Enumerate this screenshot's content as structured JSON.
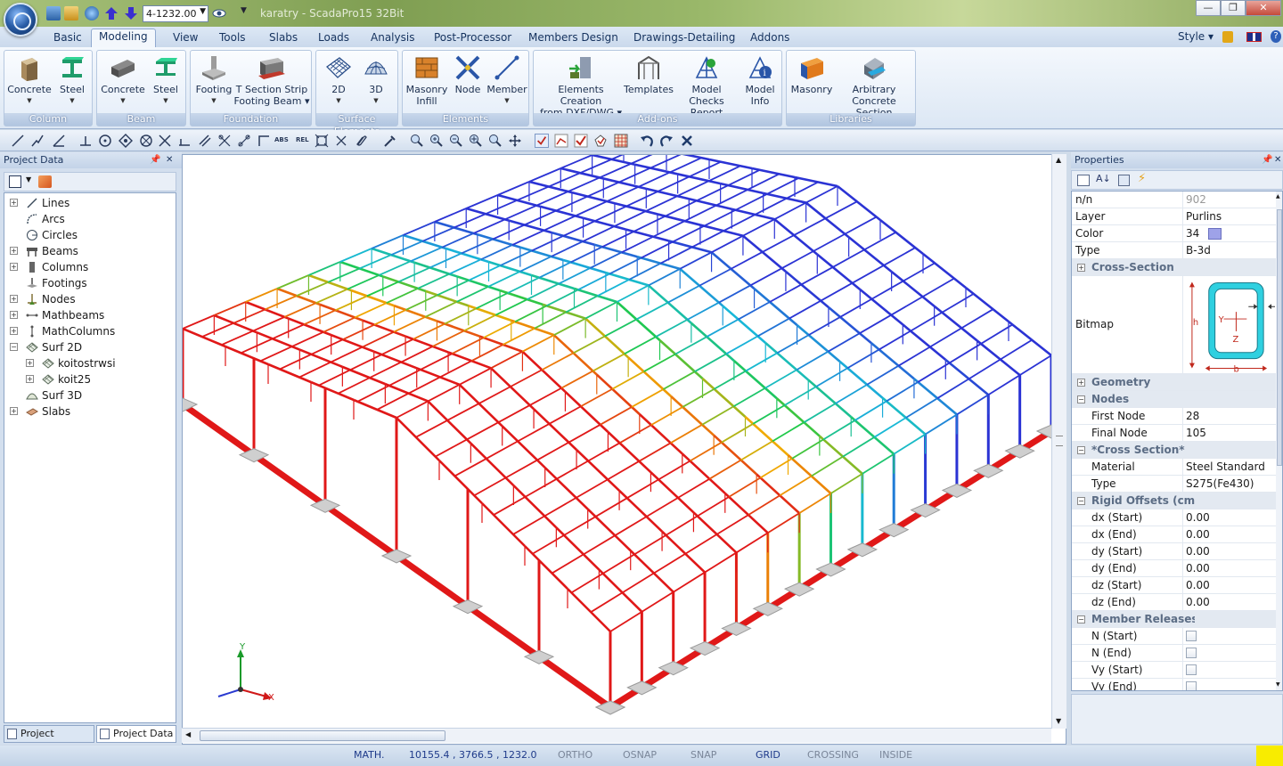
{
  "window": {
    "title": "karatry - ScadaPro15 32Bit",
    "quick_access_value": "4-1232.00"
  },
  "ribbon_tabs": [
    "Basic",
    "Modeling",
    "View",
    "Tools",
    "Slabs",
    "Loads",
    "Analysis",
    "Post-Processor",
    "Members Design",
    "Drawings-Detailing",
    "Addons"
  ],
  "active_tab": "Modeling",
  "style_label": "Style",
  "ribbon": {
    "groups": [
      {
        "label": "Column",
        "buttons": [
          "Concrete",
          "Steel"
        ]
      },
      {
        "label": "Beam",
        "buttons": [
          "Concrete",
          "Steel"
        ]
      },
      {
        "label": "Foundation",
        "buttons": [
          "Footing",
          "T Section Strip Footing Beam"
        ]
      },
      {
        "label": "Surface Elements",
        "buttons": [
          "2D",
          "3D"
        ]
      },
      {
        "label": "Elements",
        "buttons": [
          "Masonry Infill",
          "Node",
          "Member"
        ]
      },
      {
        "label": "Add-ons",
        "buttons": [
          "Elements Creation from DXF/DWG",
          "Templates",
          "Model Checks Report",
          "Model Info"
        ]
      },
      {
        "label": "Libraries",
        "buttons": [
          "Masonry",
          "Arbitrary Concrete Section"
        ]
      }
    ],
    "btn": {
      "col_concrete": "Concrete",
      "col_steel": "Steel",
      "beam_concrete": "Concrete",
      "beam_steel": "Steel",
      "footing": "Footing",
      "tsection_l1": "T Section Strip",
      "tsection_l2": "Footing Beam",
      "s2d": "2D",
      "s3d": "3D",
      "masonry_l1": "Masonry",
      "masonry_l2": "Infill",
      "node": "Node",
      "member": "Member",
      "elc_l1": "Elements Creation",
      "elc_l2": "from DXF/DWG",
      "templates": "Templates",
      "checks_l1": "Model Checks",
      "checks_l2": "Report",
      "info_l1": "Model",
      "info_l2": "Info",
      "lib_masonry": "Masonry",
      "arb_l1": "Arbitrary",
      "arb_l2": "Concrete Section"
    },
    "group_labels": {
      "column": "Column",
      "beam": "Beam",
      "foundation": "Foundation",
      "surface": "Surface Elements",
      "elements": "Elements",
      "addons": "Add-ons",
      "libraries": "Libraries"
    }
  },
  "toolbar": {
    "abs_label": "ABS",
    "rel_label": "REL"
  },
  "project_panel": {
    "title": "Project Data",
    "tree": [
      {
        "label": "Lines",
        "icon": "line-icon"
      },
      {
        "label": "Arcs",
        "icon": "arc-icon"
      },
      {
        "label": "Circles",
        "icon": "circle-icon"
      },
      {
        "label": "Beams",
        "icon": "beam-icon"
      },
      {
        "label": "Columns",
        "icon": "column-icon"
      },
      {
        "label": "Footings",
        "icon": "footing-icon"
      },
      {
        "label": "Nodes",
        "icon": "node-icon"
      },
      {
        "label": "Mathbeams",
        "icon": "mathbeam-icon"
      },
      {
        "label": "MathColumns",
        "icon": "mathcolumn-icon"
      },
      {
        "label": "Surf 2D",
        "icon": "surf2d-icon"
      },
      {
        "label": "koitostrwsi",
        "icon": "mesh-icon"
      },
      {
        "label": "koit25",
        "icon": "mesh-icon"
      },
      {
        "label": "Surf 3D",
        "icon": "surf3d-icon"
      },
      {
        "label": "Slabs",
        "icon": "slab-icon"
      }
    ],
    "bottom_tabs": [
      "Project Param...",
      "Project Data"
    ]
  },
  "viewport": {
    "axis_x": "X",
    "axis_y": "Y",
    "colors": {
      "high": "#e01818",
      "mid": "#1fc94a",
      "low": "#2b33d4",
      "footing": "#cfcfcf"
    }
  },
  "properties": {
    "title": "Properties",
    "rows": {
      "nn": {
        "k": "n/n",
        "v": "902"
      },
      "layer": {
        "k": "Layer",
        "v": "Purlins"
      },
      "color": {
        "k": "Color",
        "v": "34",
        "swatch": "#9ea2e8"
      },
      "type": {
        "k": "Type",
        "v": "B-3d"
      },
      "cross_section_cat": "Cross-Section",
      "bitmap": {
        "k": "Bitmap",
        "h": "h",
        "b": "b",
        "y": "Y",
        "z": "Z"
      },
      "geometry_cat": "Geometry",
      "nodes_cat": "Nodes",
      "first_node": {
        "k": "First Node",
        "v": "28"
      },
      "final_node": {
        "k": "Final Node",
        "v": "105"
      },
      "cross_section2_cat": "*Cross Section*",
      "material": {
        "k": "Material",
        "v": "Steel Standard"
      },
      "type2": {
        "k": "Type",
        "v": "S275(Fe430)"
      },
      "rigid_cat": "Rigid Offsets (cm)",
      "dx_start": {
        "k": "dx (Start)",
        "v": "0.00"
      },
      "dx_end": {
        "k": "dx (End)",
        "v": "0.00"
      },
      "dy_start": {
        "k": "dy (Start)",
        "v": "0.00"
      },
      "dy_end": {
        "k": "dy (End)",
        "v": "0.00"
      },
      "dz_start": {
        "k": "dz (Start)",
        "v": "0.00"
      },
      "dz_end": {
        "k": "dz (End)",
        "v": "0.00"
      },
      "releases_cat": "Member Releases",
      "n_start": {
        "k": "N (Start)"
      },
      "n_end": {
        "k": "N (End)"
      },
      "vy_start": {
        "k": "Vy (Start)"
      },
      "vy_end": {
        "k": "Vy (End)"
      }
    }
  },
  "statusbar": {
    "math": "MATH.",
    "coords": "10155.4 , 3766.5 , 1232.0",
    "ortho": "ORTHO",
    "osnap": "OSNAP",
    "snap": "SNAP",
    "grid": "GRID",
    "crossing": "CROSSING",
    "inside": "INSIDE"
  }
}
